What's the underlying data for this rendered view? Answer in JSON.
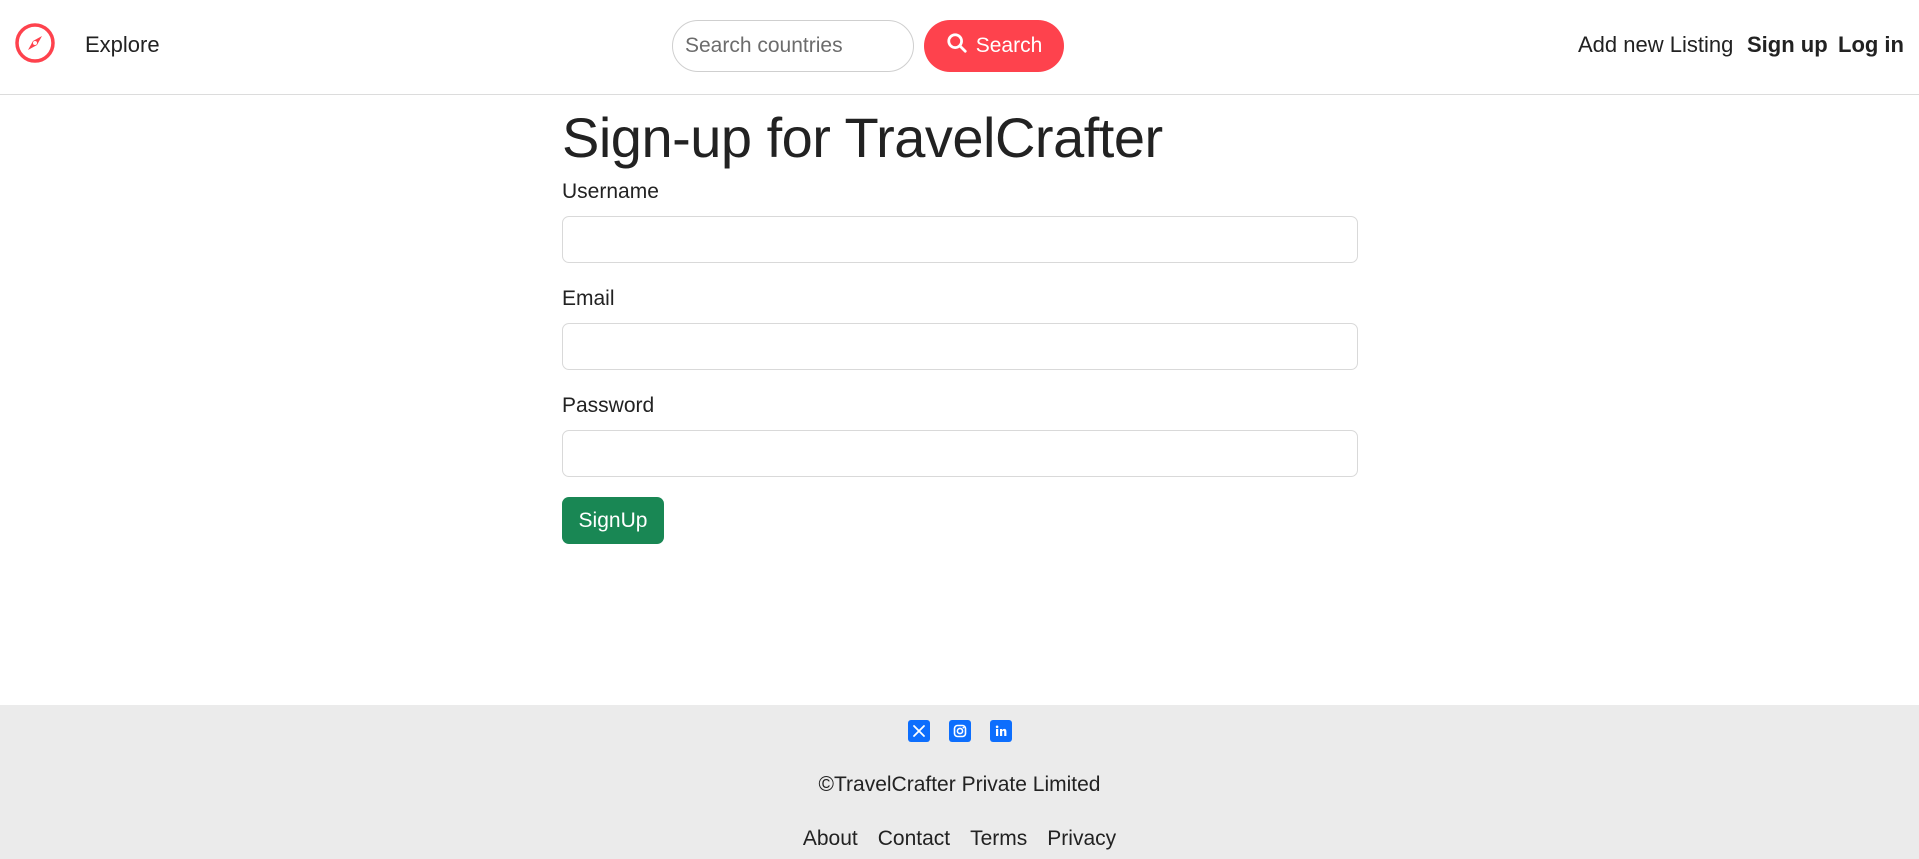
{
  "navbar": {
    "brand_icon": "compass-icon",
    "explore": "Explore",
    "search": {
      "placeholder": "Search countries",
      "button_label": "Search",
      "icon": "search-icon"
    },
    "add_listing": "Add new Listing",
    "signup": "Sign up",
    "login": "Log in"
  },
  "form": {
    "title": "Sign-up for TravelCrafter",
    "fields": [
      {
        "label": "Username",
        "value": ""
      },
      {
        "label": "Email",
        "value": ""
      },
      {
        "label": "Password",
        "value": ""
      }
    ],
    "submit_label": "SignUp"
  },
  "footer": {
    "socials": [
      "x-twitter-icon",
      "instagram-icon",
      "linkedin-icon"
    ],
    "copyright": "©TravelCrafter Private Limited",
    "links": [
      "About",
      "Contact",
      "Terms",
      "Privacy"
    ]
  },
  "colors": {
    "accent": "#fe424d",
    "submit": "#198754",
    "social": "#0d6efd",
    "footer_bg": "#ebebeb"
  }
}
